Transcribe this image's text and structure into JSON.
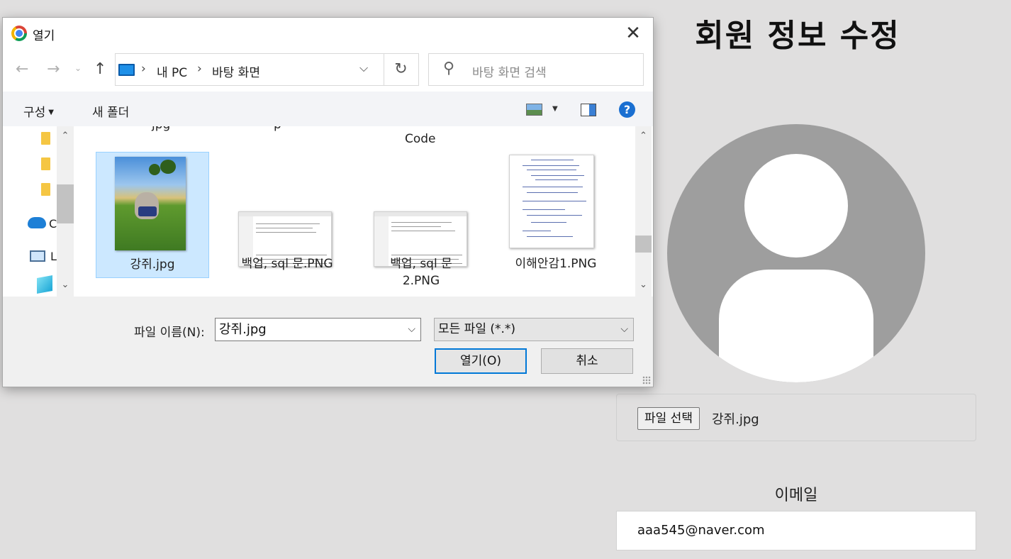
{
  "page": {
    "title": "회원 정보 수정",
    "file_button": "파일 선택",
    "file_name": "강쥐.jpg",
    "email_label": "이메일",
    "email_value": "aaa545@naver.com"
  },
  "dialog": {
    "title": "열기",
    "close": "✕",
    "breadcrumbs": [
      "내 PC",
      "바탕 화면"
    ],
    "search_placeholder": "바탕 화면 검색",
    "toolbar": {
      "organize": "구성",
      "new_folder": "새 폴더",
      "help": "?"
    },
    "nav_pane": {
      "onedrive_label": "C",
      "pc_label": "L"
    },
    "cut_off_text": [
      "jpg",
      "p"
    ],
    "code_label": "Code",
    "files": [
      {
        "name": "강쥐.jpg",
        "selected": true
      },
      {
        "name": "백업, sql 문.PNG",
        "selected": false
      },
      {
        "name": "백업, sql 문 2.PNG",
        "selected": false
      },
      {
        "name": "이해안감1.PNG",
        "selected": false
      }
    ],
    "filename_label": "파일 이름(N):",
    "filename_value": "강쥐.jpg",
    "filetype_value": "모든 파일 (*.*)",
    "open_button": "열기(O)",
    "cancel_button": "취소"
  }
}
